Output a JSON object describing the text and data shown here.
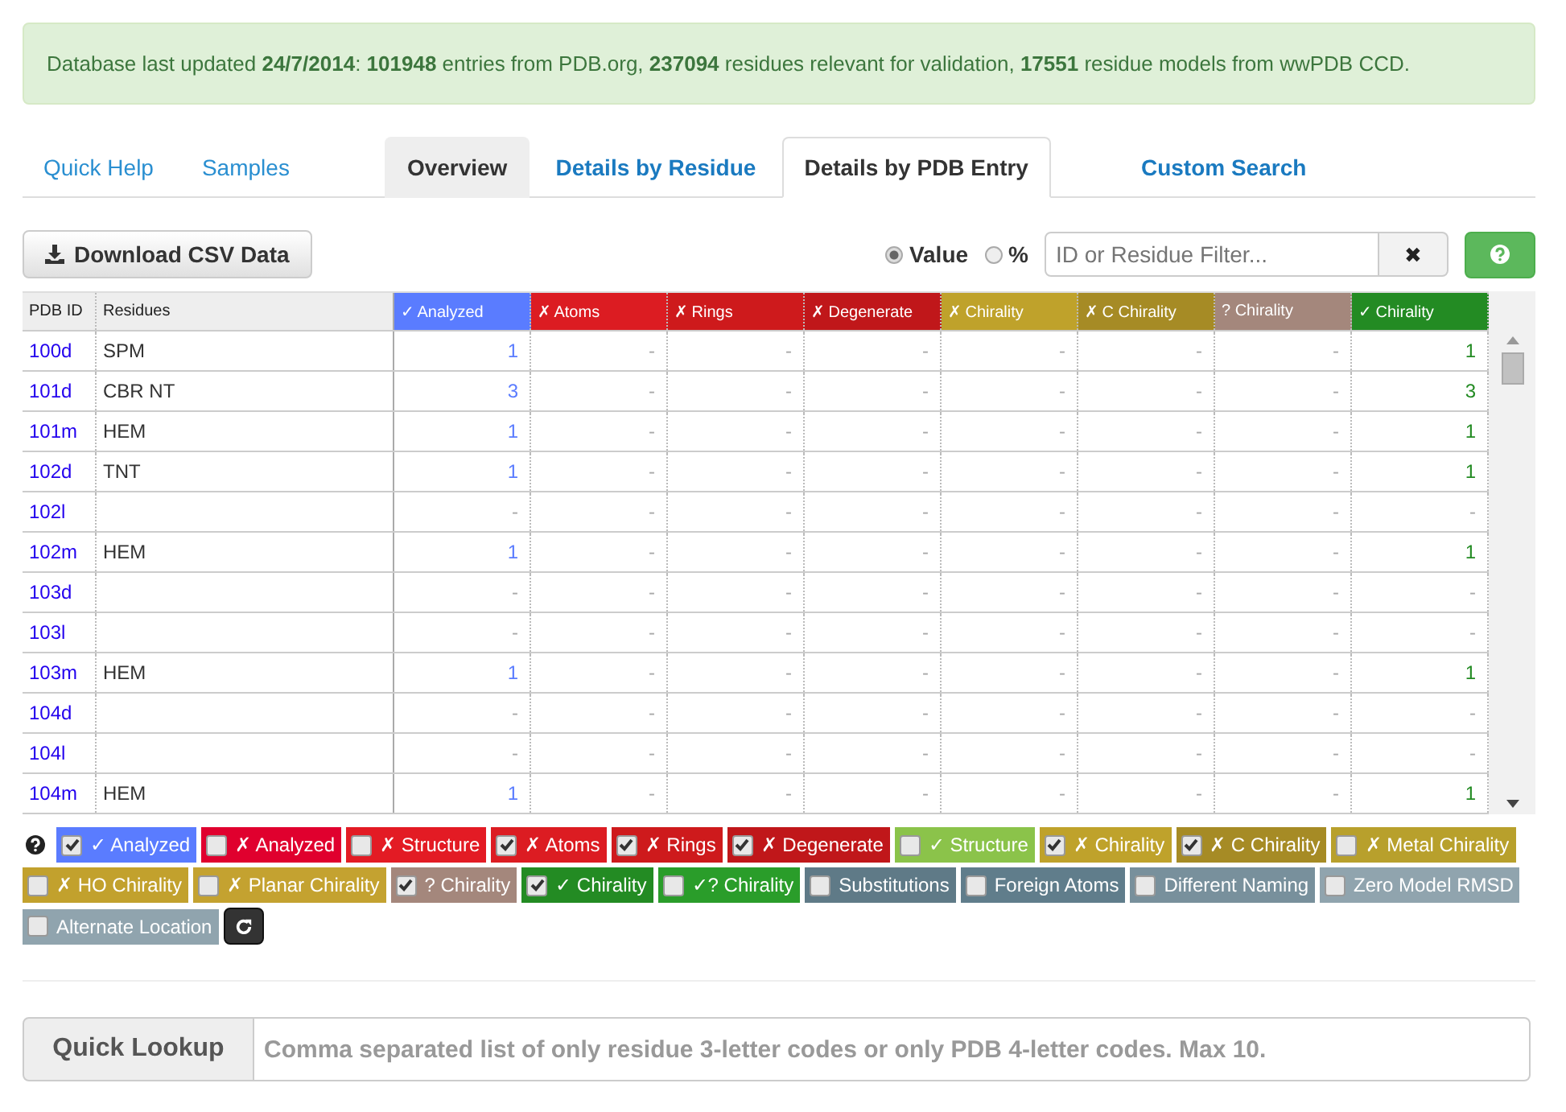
{
  "alert": "Database last updated **24/7/2014**: **101948** entries from PDB.org, **237094** residues relevant for validation, **17551** residue models from wwPDB CCD.",
  "nav_links": [
    {
      "label": "Quick Help"
    },
    {
      "label": "Samples"
    }
  ],
  "tabs": [
    {
      "label": "Overview",
      "selected": false,
      "hovered": true
    },
    {
      "label": "Details by Residue",
      "selected": false,
      "hovered": false
    },
    {
      "label": "Details by PDB Entry",
      "selected": true,
      "hovered": false
    },
    {
      "label": "Custom Search",
      "selected": false,
      "hovered": false
    }
  ],
  "toolbar": {
    "download_button": "Download CSV Data",
    "radios": [
      {
        "label": "Value",
        "selected": true
      },
      {
        "label": "%",
        "selected": false
      }
    ],
    "filter": {
      "placeholder": "ID or Residue Filter..."
    },
    "clear_button": "✖"
  },
  "table": {
    "columns": [
      {
        "label": "PDB ID",
        "color": "#eeeeee"
      },
      {
        "label": "Residues",
        "color": "#eeeeee"
      },
      {
        "label": "✓ Analyzed",
        "color": "#5a7cff"
      },
      {
        "label": "✗ Atoms",
        "color": "#dc1c22"
      },
      {
        "label": "✗ Rings",
        "color": "#ce1a1c"
      },
      {
        "label": "✗ Degenerate",
        "color": "#c0171a"
      },
      {
        "label": "✗ Chirality",
        "color": "#bfa22b"
      },
      {
        "label": "✗ C Chirality",
        "color": "#a68b25"
      },
      {
        "label": "? Chirality",
        "color": "#a4877c"
      },
      {
        "label": "✓ Chirality",
        "color": "#238b23"
      }
    ],
    "rows": [
      {
        "id": "100d",
        "residues": "SPM",
        "values": [
          "1",
          "-",
          "-",
          "-",
          "-",
          "-",
          "-",
          "1"
        ]
      },
      {
        "id": "101d",
        "residues": "CBR NT",
        "values": [
          "3",
          "-",
          "-",
          "-",
          "-",
          "-",
          "-",
          "3"
        ]
      },
      {
        "id": "101m",
        "residues": "HEM",
        "values": [
          "1",
          "-",
          "-",
          "-",
          "-",
          "-",
          "-",
          "1"
        ]
      },
      {
        "id": "102d",
        "residues": "TNT",
        "values": [
          "1",
          "-",
          "-",
          "-",
          "-",
          "-",
          "-",
          "1"
        ]
      },
      {
        "id": "102l",
        "residues": "",
        "values": [
          "-",
          "-",
          "-",
          "-",
          "-",
          "-",
          "-",
          "-"
        ]
      },
      {
        "id": "102m",
        "residues": "HEM",
        "values": [
          "1",
          "-",
          "-",
          "-",
          "-",
          "-",
          "-",
          "1"
        ]
      },
      {
        "id": "103d",
        "residues": "",
        "values": [
          "-",
          "-",
          "-",
          "-",
          "-",
          "-",
          "-",
          "-"
        ]
      },
      {
        "id": "103l",
        "residues": "",
        "values": [
          "-",
          "-",
          "-",
          "-",
          "-",
          "-",
          "-",
          "-"
        ]
      },
      {
        "id": "103m",
        "residues": "HEM",
        "values": [
          "1",
          "-",
          "-",
          "-",
          "-",
          "-",
          "-",
          "1"
        ]
      },
      {
        "id": "104d",
        "residues": "",
        "values": [
          "-",
          "-",
          "-",
          "-",
          "-",
          "-",
          "-",
          "-"
        ]
      },
      {
        "id": "104l",
        "residues": "",
        "values": [
          "-",
          "-",
          "-",
          "-",
          "-",
          "-",
          "-",
          "-"
        ]
      },
      {
        "id": "104m",
        "residues": "HEM",
        "values": [
          "1",
          "-",
          "-",
          "-",
          "-",
          "-",
          "-",
          "1"
        ]
      }
    ]
  },
  "filters": [
    {
      "label": "✓ Analyzed",
      "checked": true,
      "color": "#5a7cff"
    },
    {
      "label": "✗ Analyzed",
      "checked": false,
      "color": "#e0002e"
    },
    {
      "label": "✗ Structure",
      "checked": false,
      "color": "#e31b24"
    },
    {
      "label": "✗ Atoms",
      "checked": true,
      "color": "#dc1c22"
    },
    {
      "label": "✗ Rings",
      "checked": true,
      "color": "#ce1a1c"
    },
    {
      "label": "✗ Degenerate",
      "checked": true,
      "color": "#c0171a"
    },
    {
      "label": "✓ Structure",
      "checked": false,
      "color": "#8bc34a"
    },
    {
      "label": "✗ Chirality",
      "checked": true,
      "color": "#bfa22b"
    },
    {
      "label": "✗ C Chirality",
      "checked": true,
      "color": "#a68b25"
    },
    {
      "label": "✗ Metal Chirality",
      "checked": false,
      "color": "#b8a02c"
    },
    {
      "label": "✗ HO Chirality",
      "checked": false,
      "color": "#c2a12d"
    },
    {
      "label": "✗ Planar Chirality",
      "checked": false,
      "color": "#c4a230"
    },
    {
      "label": "? Chirality",
      "checked": true,
      "color": "#a4877c"
    },
    {
      "label": "✓ Chirality",
      "checked": true,
      "color": "#238b23"
    },
    {
      "label": "✓? Chirality",
      "checked": false,
      "color": "#2a9d2a"
    },
    {
      "label": "Substitutions",
      "checked": false,
      "color": "#5f7a87"
    },
    {
      "label": "Foreign Atoms",
      "checked": false,
      "color": "#607d8b"
    },
    {
      "label": "Different Naming",
      "checked": false,
      "color": "#78909c"
    },
    {
      "label": "Zero Model RMSD",
      "checked": false,
      "color": "#90a4ae"
    },
    {
      "label": "Alternate Location",
      "checked": false,
      "color": "#90a4ae"
    }
  ],
  "quick_lookup": {
    "label": "Quick Lookup",
    "placeholder": "Comma separated list of only residue 3-letter codes or only PDB 4-letter codes. Max 10."
  }
}
